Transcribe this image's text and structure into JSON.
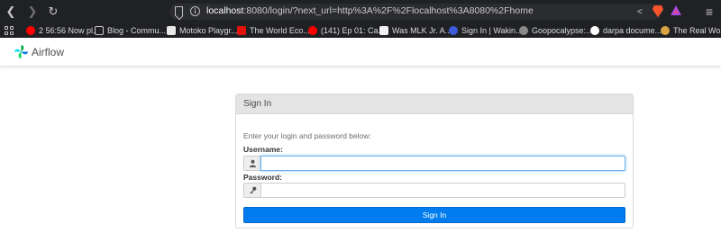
{
  "browser": {
    "url_host": "localhost",
    "url_rest": ":8080/login/?next_url=http%3A%2F%2Flocalhost%3A8080%2Fhome",
    "bookmarks": [
      {
        "label": "2 56:56 Now pl...",
        "icon": "youtube-icon",
        "color": "#ff0000"
      },
      {
        "label": "Blog - Commu...",
        "icon": "page-icon",
        "color": "#3c3c3c"
      },
      {
        "label": "Motoko Playgr...",
        "icon": "motoko-icon",
        "color": "#e8e8e8"
      },
      {
        "label": "The World Eco...",
        "icon": "economist-icon",
        "color": "#e3120b"
      },
      {
        "label": "(141) Ep 01: Ca...",
        "icon": "youtube-icon",
        "color": "#ff0000"
      },
      {
        "label": "Was MLK Jr. A...",
        "icon": "article-icon",
        "color": "#f0f0f0"
      },
      {
        "label": "Sign In | Wakin...",
        "icon": "waking-icon",
        "color": "#3b5bdb"
      },
      {
        "label": "Goopocalypse:...",
        "icon": "goop-icon",
        "color": "#8a8a8a"
      },
      {
        "label": "darpa docume...",
        "icon": "google-icon",
        "color": "#ffffff"
      },
      {
        "label": "The Real Worl...",
        "icon": "realworld-icon",
        "color": "#d9a441"
      }
    ]
  },
  "app": {
    "brand": "Airflow"
  },
  "login": {
    "panel_title": "Sign In",
    "hint": "Enter your login and password below:",
    "username_label": "Username:",
    "username_value": "",
    "password_label": "Password:",
    "password_value": "",
    "submit_label": "Sign In"
  },
  "colors": {
    "accent": "#017cee",
    "focus": "#66afe9"
  }
}
